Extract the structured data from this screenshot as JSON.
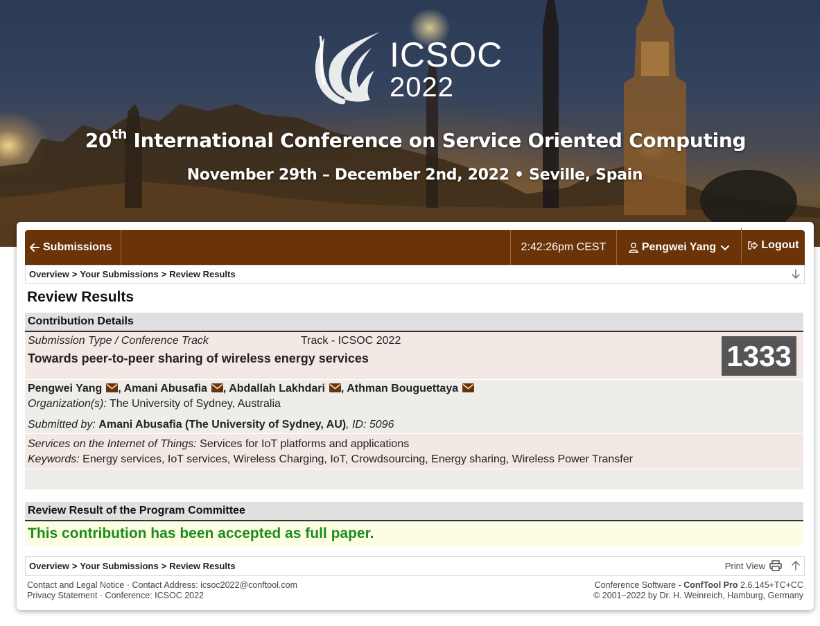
{
  "banner": {
    "logo_name": "ICSOC",
    "logo_year": "2022",
    "title_ordinal": "20",
    "title_ordinal_suffix": "th",
    "title_text": " International Conference on Service Oriented Computing",
    "date_line": "November 29th – December 2nd, 2022 • Seville, Spain"
  },
  "navbar": {
    "back_label": "Submissions",
    "time": "2:42:26pm CEST",
    "user_name": "Pengwei Yang",
    "logout_label": "Logout",
    "bar_color": "#6b3308"
  },
  "breadcrumb": {
    "items": [
      "Overview",
      "Your Submissions",
      "Review Results"
    ],
    "separator": ">"
  },
  "page_title": "Review Results",
  "details": {
    "section_title": "Contribution Details",
    "type_label": "Submission Type / Conference Track",
    "type_value": "Track - ICSOC 2022",
    "paper_title": "Towards peer-to-peer sharing of wireless energy services",
    "paper_id": "1333",
    "authors": [
      "Pengwei Yang",
      "Amani Abusafia",
      "Abdallah Lakhdari",
      "Athman Bouguettaya"
    ],
    "organization_label": "Organization(s):",
    "organization_value": "The University of Sydney, Australia",
    "submitted_by_label": "Submitted by:",
    "submitted_by_value": "Amani Abusafia (The University of Sydney, AU)",
    "submitted_by_id": ", ID: 5096",
    "topic_label": "Services on the Internet of Things:",
    "topic_value": "Services for IoT platforms and applications",
    "keywords_label": "Keywords:",
    "keywords_value": "Energy services, IoT services, Wireless Charging, IoT, Crowdsourcing, Energy sharing, Wireless Power Transfer"
  },
  "review": {
    "section_title": "Review Result of the Program Committee",
    "result": "This contribution has been accepted as full paper.",
    "result_color": "#1c8c1c"
  },
  "bottom_bar": {
    "print_label": "Print View"
  },
  "footer": {
    "contact_legal": "Contact and Legal Notice",
    "contact_address_label": "Contact Address:",
    "contact_address": "icsoc2022@conftool.com",
    "privacy": "Privacy Statement",
    "conference_label": "Conference:",
    "conference": "ICSOC 2022",
    "software_label": "Conference Software -",
    "software_name": "ConfTool Pro",
    "software_version": "2.6.145+TC+CC",
    "copyright": "© 2001–2022 by Dr. H. Weinreich, Hamburg, Germany"
  }
}
